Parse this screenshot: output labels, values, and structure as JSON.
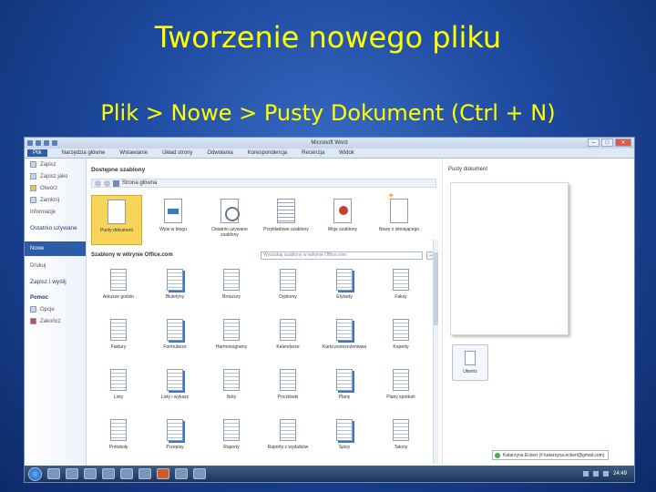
{
  "slide": {
    "title": "Tworzenie nowego pliku",
    "subtitle": "Plik > Nowe > Pusty Dokument (Ctrl + N)"
  },
  "window": {
    "title": "Microsoft Word",
    "tabs": [
      "Plik",
      "Narzędzia główne",
      "Wstawianie",
      "Układ strony",
      "Odwołania",
      "Korespondencja",
      "Recenzja",
      "Widok"
    ],
    "controls": {
      "min": "–",
      "max": "□",
      "close": "✕"
    }
  },
  "left_menu": {
    "items": [
      {
        "label": "Zapisz",
        "icon": "save-icon"
      },
      {
        "label": "Zapisz jako",
        "icon": "save-as-icon"
      },
      {
        "label": "Otwórz",
        "icon": "open-folder-icon"
      },
      {
        "label": "Zamknij",
        "icon": "close-doc-icon"
      }
    ],
    "info": "Informacje",
    "recent": "Ostatnio używane",
    "new": "Nowe",
    "print": "Drukuj",
    "save_send": "Zapisz i wyślij",
    "help": "Pomoc",
    "options": "Opcje",
    "exit": "Zakończ"
  },
  "center": {
    "heading": "Dostępne szablony",
    "home": "Strona główna",
    "top_templates": [
      {
        "label": "Pusty dokument",
        "icon": "blank-doc-icon",
        "selected": true
      },
      {
        "label": "Wpis w blogu",
        "icon": "blog-icon"
      },
      {
        "label": "Ostatnio używane szablony",
        "icon": "recent-templates-icon"
      },
      {
        "label": "Przykładowe szablony",
        "icon": "sample-templates-icon"
      },
      {
        "label": "Moje szablony",
        "icon": "my-templates-icon"
      },
      {
        "label": "Nowy z istniejącego",
        "icon": "new-from-existing-icon"
      }
    ],
    "office_label": "Szablony w witrynie Office.com",
    "search_placeholder": "Wyszukaj szablony w witrynie Office.com",
    "search_go": "→",
    "office_templates": [
      "Arkusze godzin",
      "Biuletyny",
      "Broszury",
      "Dyplomy",
      "Etykiety",
      "Faksy",
      "Faktury",
      "Formularze",
      "Harmonogramy",
      "Kalendarze",
      "Karta postrzeżeniowa",
      "Koperty",
      "Listy",
      "Listy i wykazy",
      "Noty",
      "Pocztówki",
      "Plany",
      "Plany spotkań",
      "Protokoły",
      "Przepisy",
      "Raporty",
      "Raporty z wydatków",
      "Spisy",
      "Talony"
    ]
  },
  "right": {
    "heading": "Pusty dokument",
    "create": "Utwórz"
  },
  "status_popup": "Katarzyna Eckert (# katarzyna.eckert@gmail.com)",
  "taskbar": {
    "clock": "24:49"
  }
}
